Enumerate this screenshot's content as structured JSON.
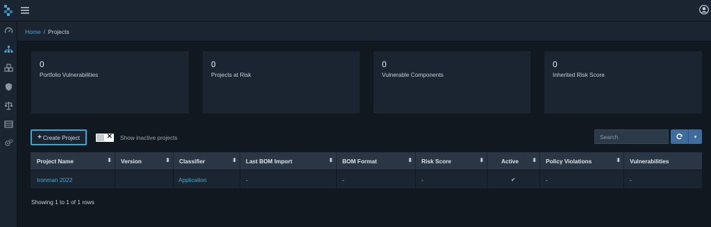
{
  "breadcrumb": {
    "home": "Home",
    "separator": "/",
    "current": "Projects"
  },
  "cards": [
    {
      "value": "0",
      "label": "Portfolio Vulnerabilities"
    },
    {
      "value": "0",
      "label": "Projects at Risk"
    },
    {
      "value": "0",
      "label": "Vulnerable Components"
    },
    {
      "value": "0",
      "label": "Inherited Risk Score"
    }
  ],
  "toolbar": {
    "create_plus": "+",
    "create_label": "Create Project",
    "inactive_toggle_x": "✕",
    "inactive_label": "Show inactive projects",
    "search_placeholder": "Search",
    "dropdown_caret": "▾"
  },
  "table": {
    "headers": [
      "Project Name",
      "Version",
      "Classifier",
      "Last BOM Import",
      "BOM Format",
      "Risk Score",
      "Active",
      "Policy Violations",
      "Vulnerabilities"
    ],
    "rows": [
      [
        "Ironman 2022",
        "",
        "Application",
        "-",
        "-",
        "-",
        "✔",
        "-",
        "-"
      ]
    ]
  },
  "footer": {
    "text": "Showing 1 to 1 of 1 rows"
  },
  "colors": {
    "accent": "#4aa8d8",
    "button": "#3e6c9d",
    "panel": "#1b2531",
    "background": "#11181f"
  },
  "icons": [
    "logo-icon",
    "menu-icon",
    "user-icon",
    "dashboard-icon",
    "projects-icon",
    "components-icon",
    "vulnerabilities-icon",
    "policy-icon",
    "licenses-icon",
    "settings-icon",
    "refresh-icon"
  ]
}
